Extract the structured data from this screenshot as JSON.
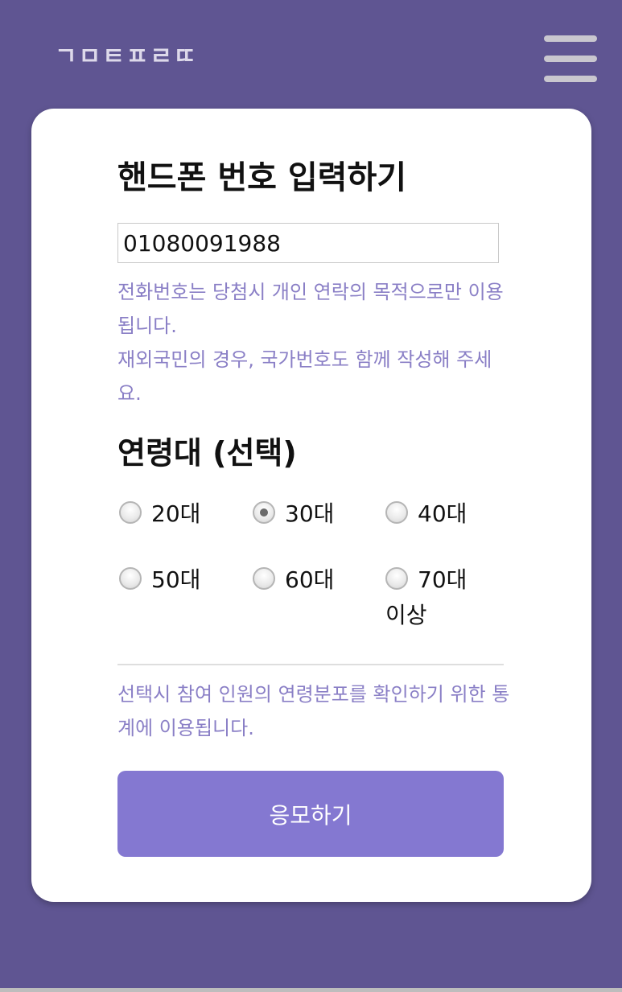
{
  "header": {
    "logo_text": "ㄱㅁㅌㅍㄹㄸ",
    "menu_icon": "hamburger-menu-icon"
  },
  "form": {
    "title": "핸드폰 번호 입력하기",
    "phone_value": "01080091988",
    "phone_notice_line1": "전화번호는 당첨시 개인 연락의 목적으로만 이용됩니다.",
    "phone_notice_line2": "재외국민의 경우, 국가번호도 함께 작성해 주세요.",
    "age_title": "연령대 (선택)",
    "age_options": [
      {
        "label": "20대",
        "checked": false
      },
      {
        "label": "30대",
        "checked": true
      },
      {
        "label": "40대",
        "checked": false
      },
      {
        "label": "50대",
        "checked": false
      },
      {
        "label": "60대",
        "checked": false
      },
      {
        "label": "70대",
        "label_line2": "이상",
        "checked": false
      }
    ],
    "age_notice": "선택시 참여 인원의 연령분포를 확인하기 위한 통계에 이용됩니다.",
    "submit_label": "응모하기"
  },
  "colors": {
    "background": "#5f5592",
    "accent_text": "#8a7fc6",
    "button": "#8478d1"
  }
}
